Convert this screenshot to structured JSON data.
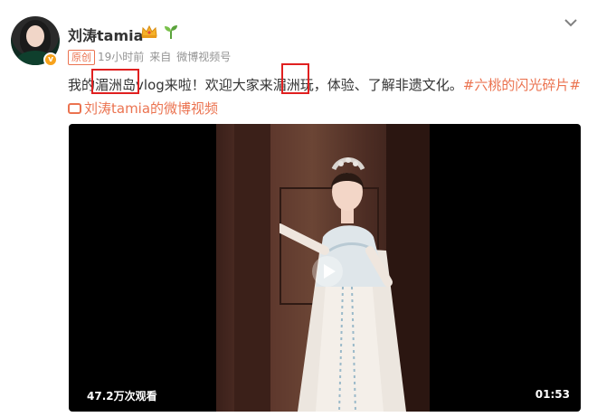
{
  "user": {
    "name": "刘涛tamia",
    "verified_badge": "v",
    "original_tag": "原创",
    "time": "19小时前",
    "from_label": "来自",
    "source": "微博视频号"
  },
  "post": {
    "t1": "我的",
    "t2": "湄洲岛",
    "t3": "vlog来啦！欢迎大家来",
    "t4": "湄洲",
    "t5": "玩，体验、了解非遗文化。",
    "hashtag": "#六桃的闪光碎片#",
    "link_text": "刘涛tamia的微博视频"
  },
  "video": {
    "views": "47.2万次观看",
    "duration": "01:53"
  },
  "colors": {
    "accent": "#eb7350",
    "highlight_box": "#e02020",
    "badge": "#f7a21b"
  },
  "icons": [
    "crown-icon",
    "sprout-icon",
    "chevron-down-icon",
    "play-icon",
    "video-link-icon"
  ]
}
